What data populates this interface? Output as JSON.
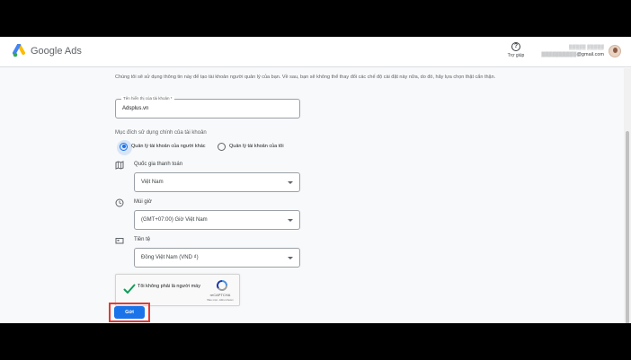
{
  "header": {
    "brand": "Google Ads",
    "help_label": "Trợ giúp",
    "account_name": "▒▒▒▒▒ ▒▒▒▒▒",
    "account_email": "▒▒▒▒▒▒▒▒▒▒@gmail.com"
  },
  "intro_text": "Chúng tôi sẽ sử dụng thông tin này để tạo tài khoản người quản lý của bạn. Về sau, bạn sẽ không thể thay đổi các chế độ cài đặt này nữa, do đó, hãy lựa chọn thật cẩn thận.",
  "display_name": {
    "label": "Tên hiển thị của tài khoản *",
    "value": "Adsplus.vn"
  },
  "purpose": {
    "label": "Mục đích sử dụng chính của tài khoản",
    "options": [
      {
        "label": "Quản lý tài khoản của người khác",
        "selected": true
      },
      {
        "label": "Quản lý tài khoản của tôi",
        "selected": false
      }
    ]
  },
  "country": {
    "label": "Quốc gia thanh toán",
    "value": "Việt Nam"
  },
  "timezone": {
    "label": "Múi giờ",
    "value": "(GMT+07:00) Giờ Việt Nam"
  },
  "currency": {
    "label": "Tiền tệ",
    "value": "Đồng Việt Nam (VND ₫)"
  },
  "captcha": {
    "text": "Tôi không phải là người máy",
    "brand": "reCAPTCHA",
    "links": "Bảo mật - Điều khoản"
  },
  "submit_label": "Gửi",
  "colors": {
    "primary": "#1a73e8",
    "highlight": "#e53935",
    "check": "#0f9d58"
  },
  "icons": [
    "google-ads-logo-icon",
    "help-icon",
    "map-icon",
    "clock-icon",
    "currency-icon",
    "checkmark-icon",
    "recaptcha-icon",
    "dropdown-caret-icon"
  ]
}
